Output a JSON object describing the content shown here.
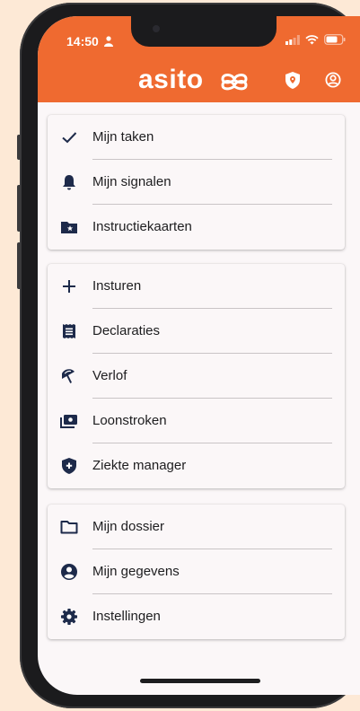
{
  "status": {
    "time": "14:50"
  },
  "header": {
    "brand": "asito",
    "accent": "#ef6a30"
  },
  "sections": [
    {
      "items": [
        {
          "label": "Mijn taken",
          "icon": "check-icon"
        },
        {
          "label": "Mijn signalen",
          "icon": "bell-icon"
        },
        {
          "label": "Instructiekaarten",
          "icon": "folder-star-icon"
        }
      ]
    },
    {
      "items": [
        {
          "label": "Insturen",
          "icon": "plus-icon"
        },
        {
          "label": "Declaraties",
          "icon": "receipt-icon"
        },
        {
          "label": "Verlof",
          "icon": "beach-umbrella-icon"
        },
        {
          "label": "Loonstroken",
          "icon": "payslip-icon"
        },
        {
          "label": "Ziekte manager",
          "icon": "shield-plus-icon"
        }
      ]
    },
    {
      "items": [
        {
          "label": "Mijn dossier",
          "icon": "folder-icon"
        },
        {
          "label": "Mijn gegevens",
          "icon": "account-circle-icon"
        },
        {
          "label": "Instellingen",
          "icon": "gear-icon"
        }
      ]
    }
  ]
}
